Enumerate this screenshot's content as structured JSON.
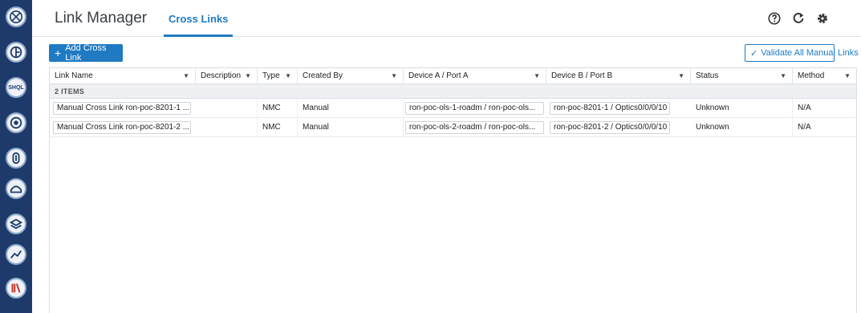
{
  "rail": {
    "icons": [
      "globe-icon",
      "gauge-icon",
      "shql-icon",
      "orbit-icon",
      "link-icon",
      "map-icon",
      "layers-icon",
      "trend-icon",
      "book-icon"
    ],
    "shql_text": "SHQL"
  },
  "header": {
    "app_title": "Link Manager",
    "tab_label": "Cross Links",
    "accent": "#1f7ac2"
  },
  "toolbar": {
    "add_label": "Add Cross Link",
    "validate_label": "Validate All Manual Links"
  },
  "grid": {
    "columns": [
      "Link Name",
      "Description",
      "Type",
      "Created By",
      "Device A / Port A",
      "Device B / Port B",
      "Status",
      "Method"
    ],
    "group_label": "2 ITEMS",
    "rows": [
      {
        "link_name": "Manual Cross Link ron-poc-8201-1 ...",
        "description": "",
        "type": "NMC",
        "created_by": "Manual",
        "device_a": "ron-poc-ols-1-roadm / ron-poc-ols...",
        "device_b": "ron-poc-8201-1 / Optics0/0/0/10",
        "status": "Unknown",
        "method": "N/A"
      },
      {
        "link_name": "Manual Cross Link ron-poc-8201-2 ...",
        "description": "",
        "type": "NMC",
        "created_by": "Manual",
        "device_a": "ron-poc-ols-2-roadm / ron-poc-ols...",
        "device_b": "ron-poc-8201-2 / Optics0/0/0/10",
        "status": "Unknown",
        "method": "N/A"
      }
    ]
  }
}
